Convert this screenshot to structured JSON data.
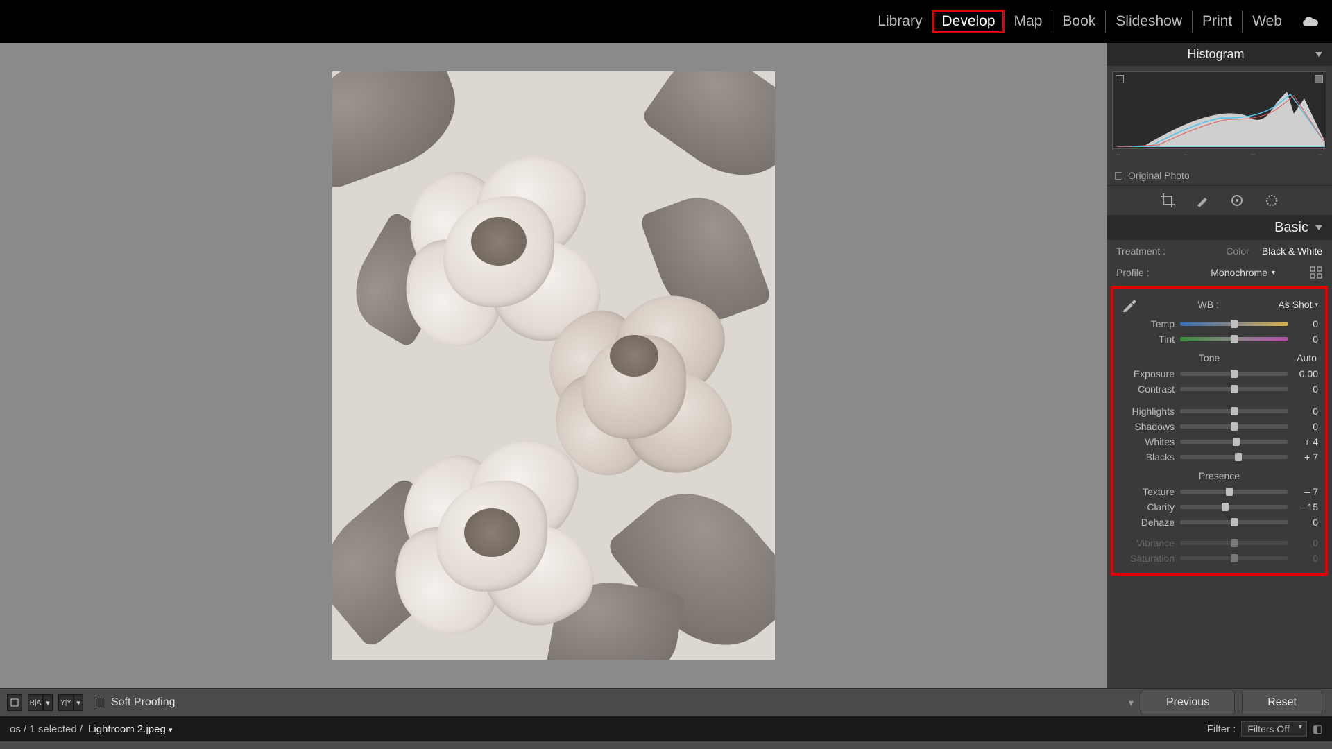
{
  "modules": {
    "library": "Library",
    "develop": "Develop",
    "map": "Map",
    "book": "Book",
    "slideshow": "Slideshow",
    "print": "Print",
    "web": "Web"
  },
  "histogram": {
    "title": "Histogram",
    "marks": [
      "–",
      "–",
      "–",
      "–"
    ],
    "original_photo": "Original Photo"
  },
  "basic": {
    "title": "Basic",
    "treatment_label": "Treatment :",
    "color": "Color",
    "bw": "Black & White",
    "profile_label": "Profile :",
    "profile_value": "Monochrome",
    "wb_label": "WB :",
    "wb_value": "As Shot",
    "tone": "Tone",
    "auto": "Auto",
    "presence": "Presence",
    "sliders": {
      "temp": {
        "label": "Temp",
        "value": "0",
        "pos": 50
      },
      "tint": {
        "label": "Tint",
        "value": "0",
        "pos": 50
      },
      "exposure": {
        "label": "Exposure",
        "value": "0.00",
        "pos": 50
      },
      "contrast": {
        "label": "Contrast",
        "value": "0",
        "pos": 50
      },
      "highlights": {
        "label": "Highlights",
        "value": "0",
        "pos": 50
      },
      "shadows": {
        "label": "Shadows",
        "value": "0",
        "pos": 50
      },
      "whites": {
        "label": "Whites",
        "value": "+ 4",
        "pos": 52
      },
      "blacks": {
        "label": "Blacks",
        "value": "+ 7",
        "pos": 54
      },
      "texture": {
        "label": "Texture",
        "value": "– 7",
        "pos": 46
      },
      "clarity": {
        "label": "Clarity",
        "value": "– 15",
        "pos": 42
      },
      "dehaze": {
        "label": "Dehaze",
        "value": "0",
        "pos": 50
      },
      "vibrance": {
        "label": "Vibrance",
        "value": "0",
        "pos": 50
      },
      "saturation": {
        "label": "Saturation",
        "value": "0",
        "pos": 50
      }
    }
  },
  "toolbar": {
    "soft_proofing": "Soft Proofing",
    "previous": "Previous",
    "reset": "Reset"
  },
  "status": {
    "selection": "os  / 1 selected  /",
    "filename": "Lightroom 2.jpeg",
    "filter_label": "Filter :",
    "filter_value": "Filters Off"
  }
}
